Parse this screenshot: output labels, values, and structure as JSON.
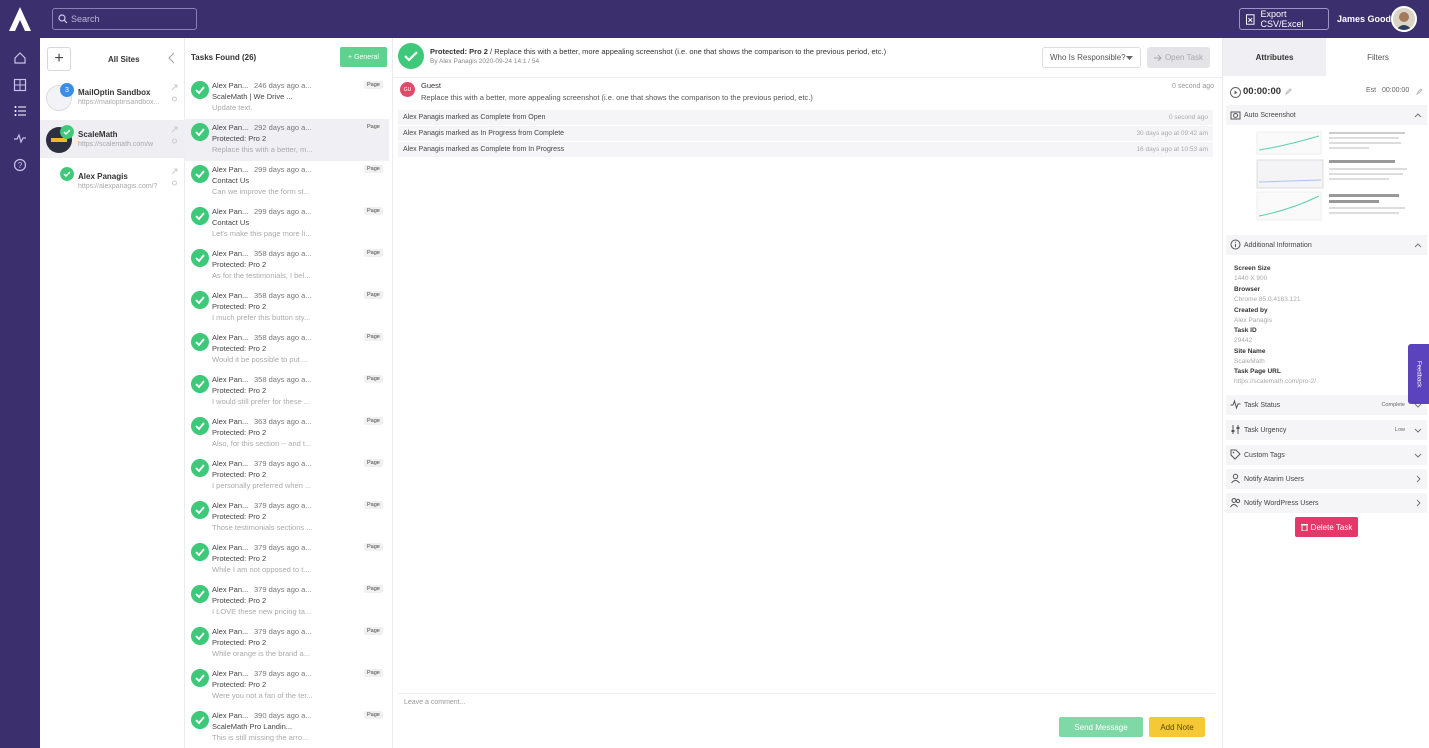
{
  "topbar": {
    "search_placeholder": "Search",
    "export_label": "Export CSV/Excel",
    "user_name": "James Good"
  },
  "sites": {
    "all_label": "All Sites",
    "items": [
      {
        "name": "MailOptin Sandbox",
        "url": "https://mailoptinsandbox...",
        "badge": "3"
      },
      {
        "name": "ScaleMath",
        "url": "https://scalemath.com/w"
      },
      {
        "name": "Alex Panagis",
        "url": "https://alexpanagis.com/?"
      }
    ]
  },
  "tasks": {
    "title": "Tasks Found (26)",
    "general_label": "+ General",
    "items": [
      {
        "author": "Alex Pan...",
        "time": "246 days ago a...",
        "page": "ScaleMath | We Drive ...",
        "snippet": "Update text.",
        "tag": "Page"
      },
      {
        "author": "Alex Pan...",
        "time": "292 days ago a...",
        "page": "Protected: Pro 2",
        "snippet": "Replace this with a better, m...",
        "tag": "Page"
      },
      {
        "author": "Alex Pan...",
        "time": "299 days ago a...",
        "page": "Contact Us",
        "snippet": "Can we improve the form st...",
        "tag": "Page"
      },
      {
        "author": "Alex Pan...",
        "time": "299 days ago a...",
        "page": "Contact Us",
        "snippet": "Let's make this page more li...",
        "tag": "Page"
      },
      {
        "author": "Alex Pan...",
        "time": "358 days ago a...",
        "page": "Protected: Pro 2",
        "snippet": "As for the testimonials, I bel...",
        "tag": "Page"
      },
      {
        "author": "Alex Pan...",
        "time": "358 days ago a...",
        "page": "Protected: Pro 2",
        "snippet": "I much prefer this button sty...",
        "tag": "Page"
      },
      {
        "author": "Alex Pan...",
        "time": "358 days ago a...",
        "page": "Protected: Pro 2",
        "snippet": "Would it be possible to put ...",
        "tag": "Page"
      },
      {
        "author": "Alex Pan...",
        "time": "358 days ago a...",
        "page": "Protected: Pro 2",
        "snippet": "I would still prefer for these ...",
        "tag": "Page"
      },
      {
        "author": "Alex Pan...",
        "time": "363 days ago a...",
        "page": "Protected: Pro 2",
        "snippet": "Also, for this section -- and t...",
        "tag": "Page"
      },
      {
        "author": "Alex Pan...",
        "time": "379 days ago a...",
        "page": "Protected: Pro 2",
        "snippet": "I personally preferred when ...",
        "tag": "Page"
      },
      {
        "author": "Alex Pan...",
        "time": "379 days ago a...",
        "page": "Protected: Pro 2",
        "snippet": "Those testimonials sections ...",
        "tag": "Page"
      },
      {
        "author": "Alex Pan...",
        "time": "379 days ago a...",
        "page": "Protected: Pro 2",
        "snippet": "While I am not opposed to t...",
        "tag": "Page"
      },
      {
        "author": "Alex Pan...",
        "time": "379 days ago a...",
        "page": "Protected: Pro 2",
        "snippet": "I LOVE these new pricing ta...",
        "tag": "Page"
      },
      {
        "author": "Alex Pan...",
        "time": "379 days ago a...",
        "page": "Protected: Pro 2",
        "snippet": "While orange is the brand a...",
        "tag": "Page"
      },
      {
        "author": "Alex Pan...",
        "time": "379 days ago a...",
        "page": "Protected: Pro 2",
        "snippet": "Were you not a fan of the ter...",
        "tag": "Page"
      },
      {
        "author": "Alex Pan...",
        "time": "390 days ago a...",
        "page": "ScaleMath Pro Landin...",
        "snippet": "This is still missing the arro...",
        "tag": "Page"
      }
    ]
  },
  "main": {
    "title_page": "Protected: Pro 2",
    "title_sep": "/",
    "title_text": "Replace this with a better, more appealing screenshot (i.e. one that shows the comparison to the previous period, etc.)",
    "subtitle": "By Alex Panagis 2020-09-24 14:1 / 54",
    "responsible_label": "Who Is Responsible?",
    "open_task_label": "Open Task",
    "guest_initials": "GU",
    "guest_name": "Guest",
    "guest_time": "0 second ago",
    "guest_message": "Replace this with a better, more appealing screenshot (i.e. one that shows the comparison to the previous period, etc.)",
    "log": [
      {
        "text": "Alex Panagis marked as Complete from Open",
        "time": "0 second ago"
      },
      {
        "text": "Alex Panagis marked as In Progress from Complete",
        "time": "30 days ago at 09:42 am"
      },
      {
        "text": "Alex Panagis marked as Complete from In Progress",
        "time": "16 days ago at 10:53 am"
      }
    ],
    "comment_placeholder": "Leave a comment...",
    "send_label": "Send Message",
    "note_label": "Add Note"
  },
  "right": {
    "tab_attributes": "Attributes",
    "tab_filters": "Filters",
    "timer": "00:00:00",
    "est_label": "Est",
    "est_value": "00:00:00",
    "auto_screenshot": "Auto Screenshot",
    "additional_info": "Additional Information",
    "info": [
      {
        "label": "Screen Size",
        "value": "1440 X 900"
      },
      {
        "label": "Browser",
        "value": "Chrome 85.0.4183.121"
      },
      {
        "label": "Created by",
        "value": "Alex Panagis"
      },
      {
        "label": "Task ID",
        "value": "29442"
      },
      {
        "label": "Site Name",
        "value": "ScaleMath"
      },
      {
        "label": "Task Page URL",
        "value": "https://scalemath.com/pro-2/"
      }
    ],
    "task_status": "Task Status",
    "task_status_value": "Complete",
    "task_urgency": "Task Urgency",
    "task_urgency_value": "Low",
    "custom_tags": "Custom Tags",
    "notify_atarim": "Notify Atarim Users",
    "notify_wp": "Notify WordPress Users",
    "delete_label": "Delete Task"
  },
  "feedback_label": "Feedback",
  "colors": {
    "brand": "#3c2f6e",
    "success": "#3ec97a",
    "delete": "#e4386a",
    "note": "#f5c935"
  }
}
